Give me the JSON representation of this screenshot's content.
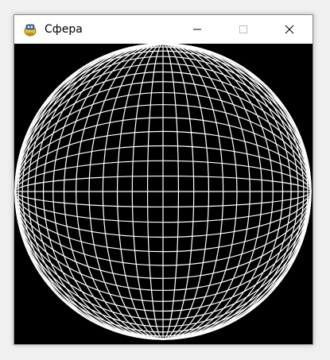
{
  "window": {
    "title": "Сфера"
  },
  "colors": {
    "background": "#000000",
    "wire": "#ffffff",
    "titlebar": "#ffffff"
  },
  "icons": {
    "app": "pygame-snake-icon",
    "minimize": "minimize-icon",
    "maximize": "maximize-icon",
    "close": "close-icon"
  },
  "sphere": {
    "latitude_lines": 30,
    "longitude_lines": 30
  }
}
